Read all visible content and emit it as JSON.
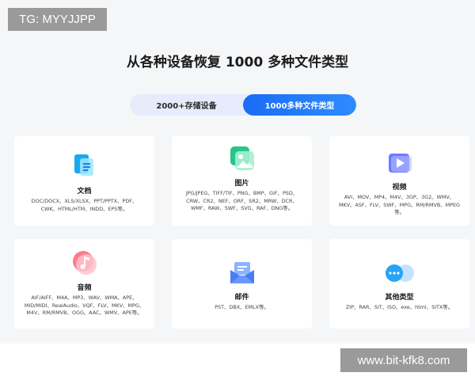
{
  "badge": "TG: MYYJJPP",
  "headline": "从各种设备恢复 1000 多种文件类型",
  "tabs": [
    {
      "label": "2000+存储设备",
      "active": false
    },
    {
      "label": "1000多种文件类型",
      "active": true
    }
  ],
  "cards": [
    {
      "title": "文档",
      "icon": "document-icon",
      "desc": "DOC/DOCX、XLS/XLSX、PPT/PPTX、PDF、CWK、HTML/HTM、INDD、EPS等。"
    },
    {
      "title": "图片",
      "icon": "image-icon",
      "desc": "JPG/JPEG、TIFF/TIF、PNG、BMP、GIF、PSD、CRW、CR2、NEF、ORF、SR2、MRW、DCR、WMF、RAW、SWF、SVG、RAF、DNG等。"
    },
    {
      "title": "视频",
      "icon": "video-icon",
      "desc": "AVI、MOV、MP4、M4V、3GP、3G2、WMV、MKV、ASF、FLV、SWF、MPG、RM/RMVB、MPEG等。"
    },
    {
      "title": "音频",
      "icon": "music-icon",
      "desc": "AIF/AIFF、M4A、MP3、WAV、WMA、APE、MID/MIDI、RealAudio、VQF、FLV、MKV、MPG、M4V、RM/RMVB、OGG、AAC、WMV、APE等。"
    },
    {
      "title": "邮件",
      "icon": "email-icon",
      "desc": "PST、DBX、EMLX等。"
    },
    {
      "title": "其他类型",
      "icon": "chat-bubbles-icon",
      "desc": "ZIP、RAR、SIT、ISO、exe、html、SITX等。"
    }
  ],
  "watermark": "www.bit-kfk8.com"
}
